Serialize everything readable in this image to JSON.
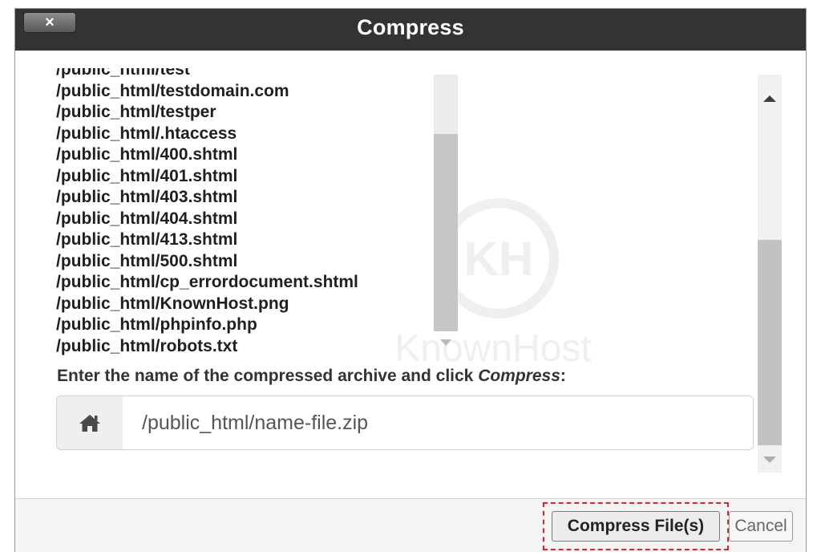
{
  "dialog": {
    "title": "Compress",
    "close_label": "×"
  },
  "files": [
    "/public_html/test",
    "/public_html/testdomain.com",
    "/public_html/testper",
    "/public_html/.htaccess",
    "/public_html/400.shtml",
    "/public_html/401.shtml",
    "/public_html/403.shtml",
    "/public_html/404.shtml",
    "/public_html/413.shtml",
    "/public_html/500.shtml",
    "/public_html/cp_errordocument.shtml",
    "/public_html/KnownHost.png",
    "/public_html/phpinfo.php",
    "/public_html/robots.txt"
  ],
  "instruction": {
    "text": "Enter the name of the compressed archive and click ",
    "emphasis": "Compress",
    "suffix": ":"
  },
  "archive_input": {
    "value": "/public_html/name-file.zip",
    "icon": "home-icon"
  },
  "watermark": {
    "logo_text": "KH",
    "brand_text": "KnownHost"
  },
  "footer": {
    "compress_label": "Compress File(s)",
    "cancel_label": "Cancel"
  },
  "colors": {
    "titlebar": "#333333",
    "highlight": "#e8202a"
  }
}
